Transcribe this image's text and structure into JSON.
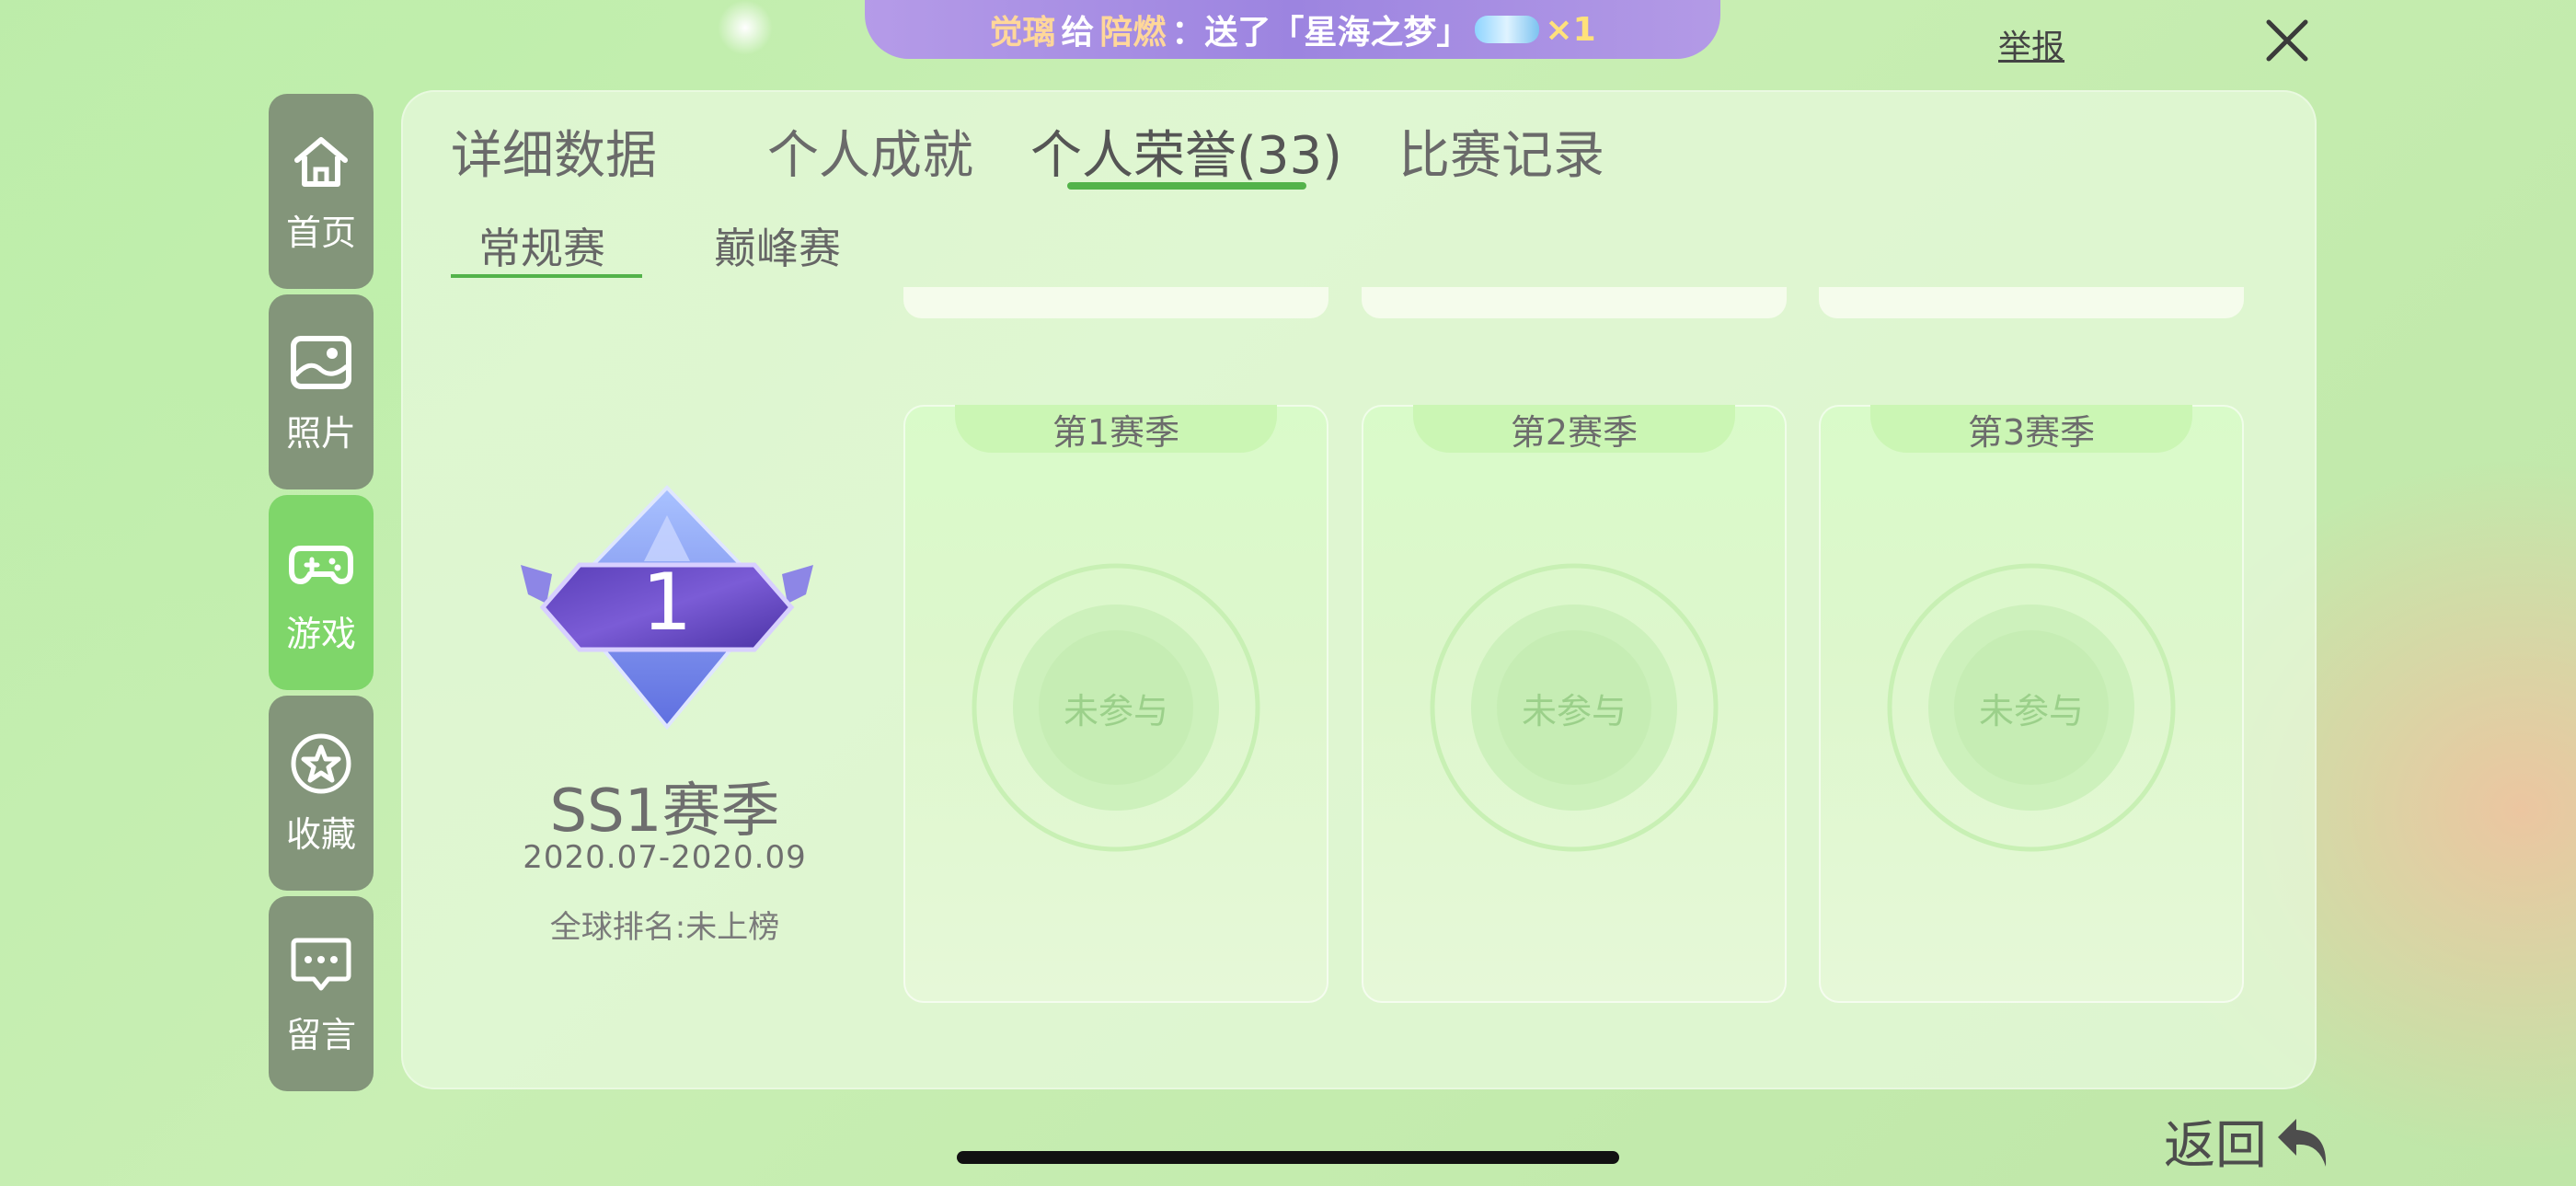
{
  "gift_banner": {
    "sender": "觉璃",
    "connector": "给",
    "receiver": "陪燃",
    "message": "：送了「星海之梦」",
    "count": "×1"
  },
  "header": {
    "report_label": "举报",
    "close_icon": "close-icon"
  },
  "sidebar": {
    "items": [
      {
        "label": "首页",
        "icon": "home-icon"
      },
      {
        "label": "照片",
        "icon": "photo-icon"
      },
      {
        "label": "游戏",
        "icon": "gamepad-icon",
        "active": true
      },
      {
        "label": "收藏",
        "icon": "star-icon"
      },
      {
        "label": "留言",
        "icon": "message-icon"
      }
    ]
  },
  "tabs": [
    {
      "label": "详细数据"
    },
    {
      "label": "个人成就"
    },
    {
      "label": "个人荣誉(33)",
      "active": true
    },
    {
      "label": "比赛记录"
    }
  ],
  "subtabs": [
    {
      "label": "常规赛",
      "active": true
    },
    {
      "label": "巅峰赛"
    }
  ],
  "season_summary": {
    "badge_number": "1",
    "title": "SS1赛季",
    "dates": "2020.07-2020.09",
    "rank": "全球排名:未上榜"
  },
  "seasons": [
    {
      "label": "第1赛季",
      "status": "未参与"
    },
    {
      "label": "第2赛季",
      "status": "未参与"
    },
    {
      "label": "第3赛季",
      "status": "未参与"
    }
  ],
  "footer": {
    "back_label": "返回"
  },
  "colors": {
    "accent": "#53b34a",
    "nav_active": "#7fd66a",
    "nav_inactive": "#83957a",
    "banner": "#9c84e0"
  }
}
